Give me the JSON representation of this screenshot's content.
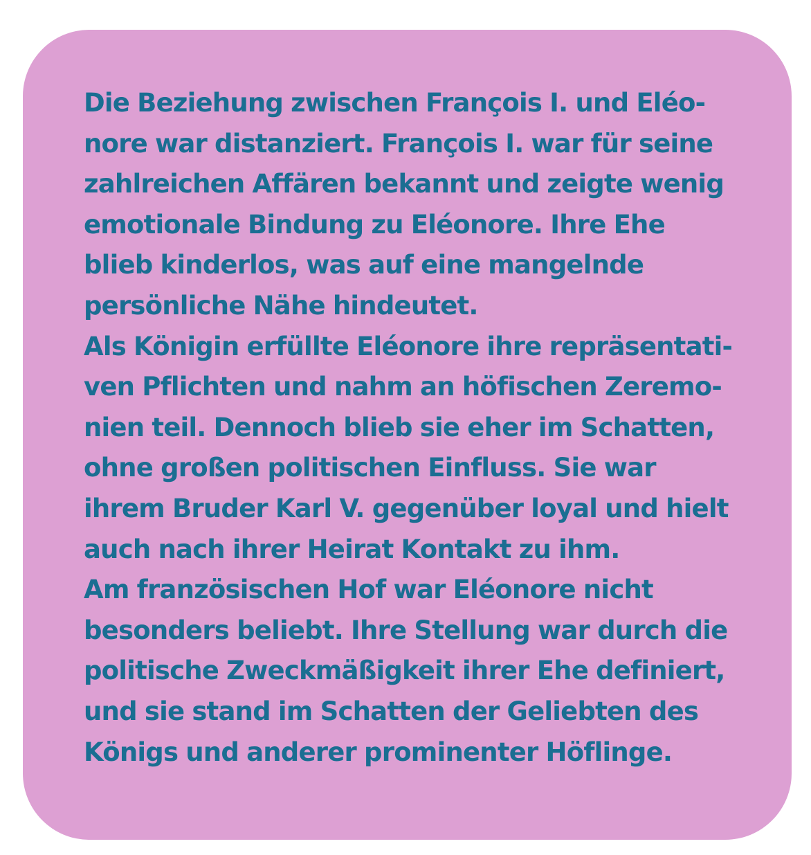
{
  "paragraphs": [
    {
      "lines": [
        "Die Beziehung zwischen François I. und Eléo-",
        "nore war distanziert. François I. war für seine",
        "zahlreichen Affären bekannt und zeigte wenig",
        "emotionale Bindung zu Eléonore. Ihre Ehe",
        "blieb kinderlos, was auf eine mangelnde",
        "persönliche Nähe hindeutet."
      ]
    },
    {
      "lines": [
        "Als Königin erfüllte Eléonore ihre repräsentati-",
        "ven Pflichten und nahm an höfischen Zeremo-",
        "nien teil. Dennoch blieb sie eher im Schatten,",
        "ohne großen politischen Einfluss. Sie war",
        "ihrem Bruder Karl V. gegenüber loyal und hielt",
        "auch nach ihrer Heirat Kontakt zu ihm."
      ]
    },
    {
      "lines": [
        "Am französischen Hof war Eléonore nicht",
        "besonders beliebt. Ihre Stellung war durch die",
        "politische Zweckmäßigkeit ihrer Ehe definiert,",
        "und sie stand im Schatten der Geliebten des",
        "Königs und anderer prominenter Höflinge."
      ]
    }
  ],
  "colors": {
    "card_background": "#dda0d3",
    "text": "#1a6e92"
  }
}
